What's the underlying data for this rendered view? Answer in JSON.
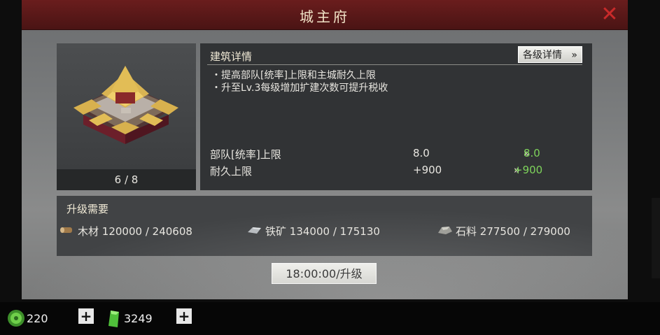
{
  "dialog": {
    "title": "城主府",
    "close_label": "✕"
  },
  "building": {
    "level_text": "6 / 8"
  },
  "details": {
    "section_title": "建筑详情",
    "levels_button": "各级详情",
    "levels_button_chevron": "»",
    "bullets": [
      "・提高部队[统率]上限和主城耐久上限",
      "・升至Lv.3每级增加扩建次数可提升税收"
    ],
    "stats": [
      {
        "name": "部队[统率]上限",
        "current": "8.0",
        "arrow": "»",
        "next": "8.0"
      },
      {
        "name": "耐久上限",
        "current": "+900",
        "arrow": "»",
        "next": "+900"
      }
    ]
  },
  "requirements": {
    "title": "升级需要",
    "resources": [
      {
        "icon": "wood-icon",
        "name": "木材",
        "amount": "120000 / 240608"
      },
      {
        "icon": "iron-ore-icon",
        "name": "铁矿",
        "amount": "134000 / 175130"
      },
      {
        "icon": "stone-icon",
        "name": "石料",
        "amount": "277500 / 279000"
      }
    ]
  },
  "upgrade_button": "18:00:00/升级",
  "currencies": [
    {
      "icon": "jade-coin-icon",
      "value": "220",
      "plus": "+"
    },
    {
      "icon": "green-gem-icon",
      "value": "3249",
      "plus": "+"
    }
  ],
  "colors": {
    "title_bar": "#5a1818",
    "close": "#c92a2a",
    "bonus_green": "#7ed35b"
  }
}
